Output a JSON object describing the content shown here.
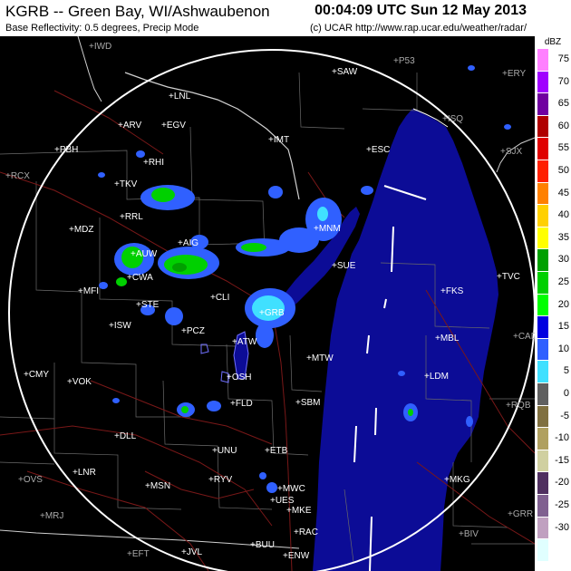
{
  "header": {
    "title": "KGRB -- Green Bay, WI/Ashwaubenon",
    "timestamp": "00:04:09 UTC Sun 12 May 2013",
    "subtitle": "Base Reflectivity: 0.5 degrees, Precip Mode",
    "credit": "(c) UCAR  http://www.rap.ucar.edu/weather/radar/"
  },
  "legend": {
    "unit": "dBZ",
    "levels": [
      {
        "value": "75",
        "color": "#ff80ff"
      },
      {
        "value": "70",
        "color": "#a000ff"
      },
      {
        "value": "65",
        "color": "#7000a0"
      },
      {
        "value": "60",
        "color": "#b00000"
      },
      {
        "value": "55",
        "color": "#e00000"
      },
      {
        "value": "50",
        "color": "#ff2000"
      },
      {
        "value": "45",
        "color": "#ff8000"
      },
      {
        "value": "40",
        "color": "#ffd000"
      },
      {
        "value": "35",
        "color": "#ffff00"
      },
      {
        "value": "30",
        "color": "#00a000"
      },
      {
        "value": "25",
        "color": "#00d000"
      },
      {
        "value": "20",
        "color": "#00ff00"
      },
      {
        "value": "15",
        "color": "#0000e0"
      },
      {
        "value": "10",
        "color": "#3060ff"
      },
      {
        "value": "5",
        "color": "#40e0ff"
      },
      {
        "value": "0",
        "color": "#606060"
      },
      {
        "value": "-5",
        "color": "#807040"
      },
      {
        "value": "-10",
        "color": "#b0a060"
      },
      {
        "value": "-15",
        "color": "#d0d0a0"
      },
      {
        "value": "-20",
        "color": "#503060"
      },
      {
        "value": "-25",
        "color": "#806090"
      },
      {
        "value": "-30",
        "color": "#c0a0c0"
      },
      {
        "value": "",
        "color": "#e0ffff"
      }
    ]
  },
  "stations": [
    {
      "id": "IWD"
    },
    {
      "id": "SAW"
    },
    {
      "id": "P53"
    },
    {
      "id": "ERY"
    },
    {
      "id": "LNL"
    },
    {
      "id": "ARV"
    },
    {
      "id": "EGV"
    },
    {
      "id": "IMT"
    },
    {
      "id": "ISQ"
    },
    {
      "id": "ESC"
    },
    {
      "id": "SJX"
    },
    {
      "id": "PBH"
    },
    {
      "id": "RHI"
    },
    {
      "id": "RCX"
    },
    {
      "id": "TKV"
    },
    {
      "id": "RRL"
    },
    {
      "id": "MNM"
    },
    {
      "id": "MDZ"
    },
    {
      "id": "AUW"
    },
    {
      "id": "AIG"
    },
    {
      "id": "SUE"
    },
    {
      "id": "GRB"
    },
    {
      "id": "TVC"
    },
    {
      "id": "CWA"
    },
    {
      "id": "MFI"
    },
    {
      "id": "STE"
    },
    {
      "id": "CLI"
    },
    {
      "id": "FKS"
    },
    {
      "id": "ISW"
    },
    {
      "id": "PCZ"
    },
    {
      "id": "ATW"
    },
    {
      "id": "MBL"
    },
    {
      "id": "CAD"
    },
    {
      "id": "MTW"
    },
    {
      "id": "CMY"
    },
    {
      "id": "VOK"
    },
    {
      "id": "OSH"
    },
    {
      "id": "LDM"
    },
    {
      "id": "FLD"
    },
    {
      "id": "SBM"
    },
    {
      "id": "RQB"
    },
    {
      "id": "DLL"
    },
    {
      "id": "UNU"
    },
    {
      "id": "ETB"
    },
    {
      "id": "LNR"
    },
    {
      "id": "MSN"
    },
    {
      "id": "RYV"
    },
    {
      "id": "OVS"
    },
    {
      "id": "MWC"
    },
    {
      "id": "UES"
    },
    {
      "id": "MKG"
    },
    {
      "id": "MKE"
    },
    {
      "id": "MRJ"
    },
    {
      "id": "RAC"
    },
    {
      "id": "GRR"
    },
    {
      "id": "BIV"
    },
    {
      "id": "EFT"
    },
    {
      "id": "JVL"
    },
    {
      "id": "BUU"
    },
    {
      "id": "ENW"
    }
  ]
}
